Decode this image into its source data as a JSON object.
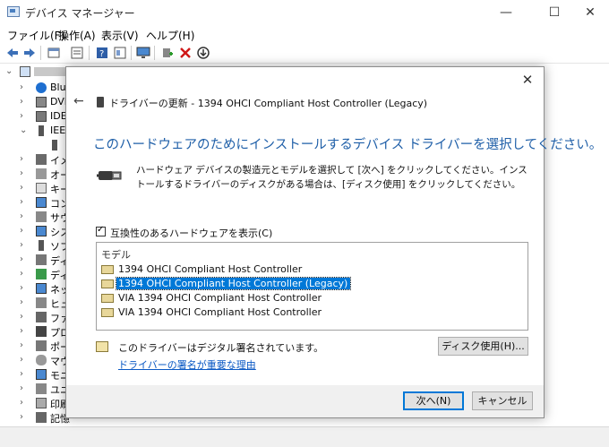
{
  "window": {
    "title": "デバイス マネージャー",
    "minimize": "—",
    "maximize": "☐",
    "close": "✕"
  },
  "menu": [
    "ファイル(F)",
    "操作(A)",
    "表示(V)",
    "ヘルプ(H)"
  ],
  "toolbar_icons": [
    "back-icon",
    "forward-icon",
    "properties-icon",
    "list-icon",
    "help-icon",
    "view-icon",
    "monitor-icon",
    "add-driver-icon",
    "uninstall-icon",
    "disable-icon"
  ],
  "tree": {
    "root_label": "",
    "items": [
      {
        "label": "Blu",
        "icon": "bluetooth-icon",
        "expanded": false
      },
      {
        "label": "DVI",
        "icon": "dvd-icon",
        "expanded": false
      },
      {
        "label": "IDE",
        "icon": "ide-icon",
        "expanded": false
      },
      {
        "label": "IEEE",
        "icon": "ieee-icon",
        "expanded": true
      },
      {
        "label": "",
        "icon": "ieee-child-icon",
        "expanded": null
      },
      {
        "label": "イメ",
        "icon": "imaging-icon",
        "expanded": false
      },
      {
        "label": "オー",
        "icon": "audio-icon",
        "expanded": false
      },
      {
        "label": "キー",
        "icon": "keyboard-icon",
        "expanded": false
      },
      {
        "label": "コン",
        "icon": "computer-icon",
        "expanded": false
      },
      {
        "label": "サウ",
        "icon": "sound-icon",
        "expanded": false
      },
      {
        "label": "シス",
        "icon": "system-icon",
        "expanded": false
      },
      {
        "label": "ソフ",
        "icon": "software-icon",
        "expanded": false
      },
      {
        "label": "ディ",
        "icon": "disk-icon",
        "expanded": false
      },
      {
        "label": "ディ",
        "icon": "display-icon",
        "expanded": false
      },
      {
        "label": "ネッ",
        "icon": "network-icon",
        "expanded": false
      },
      {
        "label": "ヒュ",
        "icon": "hid-icon",
        "expanded": false
      },
      {
        "label": "ファ",
        "icon": "firmware-icon",
        "expanded": false
      },
      {
        "label": "プロ",
        "icon": "processor-icon",
        "expanded": false
      },
      {
        "label": "ポー",
        "icon": "port-icon",
        "expanded": false
      },
      {
        "label": "マウ",
        "icon": "mouse-icon",
        "expanded": false
      },
      {
        "label": "モニ",
        "icon": "monitor-icon",
        "expanded": false
      },
      {
        "label": "ユニ",
        "icon": "usb-icon",
        "expanded": false
      },
      {
        "label": "印刷",
        "icon": "printer-icon",
        "expanded": false
      },
      {
        "label": "記憶",
        "icon": "storage-icon",
        "expanded": false
      }
    ]
  },
  "dialog": {
    "close": "✕",
    "back": "←",
    "header_title": "ドライバーの更新 - 1394 OHCI Compliant Host Controller (Legacy)",
    "heading": "このハードウェアのためにインストールするデバイス ドライバーを選択してください。",
    "description": "ハードウェア デバイスの製造元とモデルを選択して [次へ] をクリックしてください。インストールするドライバーのディスクがある場合は、[ディスク使用] をクリックしてください。",
    "compat_checkbox": {
      "label": "互換性のあるハードウェアを表示(C)",
      "checked": true
    },
    "model_header": "モデル",
    "models": [
      {
        "label": "1394 OHCI Compliant Host Controller",
        "selected": false
      },
      {
        "label": "1394 OHCI Compliant Host Controller (Legacy)",
        "selected": true
      },
      {
        "label": "VIA 1394 OHCI Compliant Host Controller",
        "selected": false
      },
      {
        "label": "VIA 1394 OHCI Compliant Host Controller",
        "selected": false
      }
    ],
    "signed_text": "このドライバーはデジタル署名されています。",
    "signed_link": "ドライバーの署名が重要な理由",
    "disk_button": "ディスク使用(H)...",
    "next_button": "次へ(N)",
    "cancel_button": "キャンセル"
  }
}
